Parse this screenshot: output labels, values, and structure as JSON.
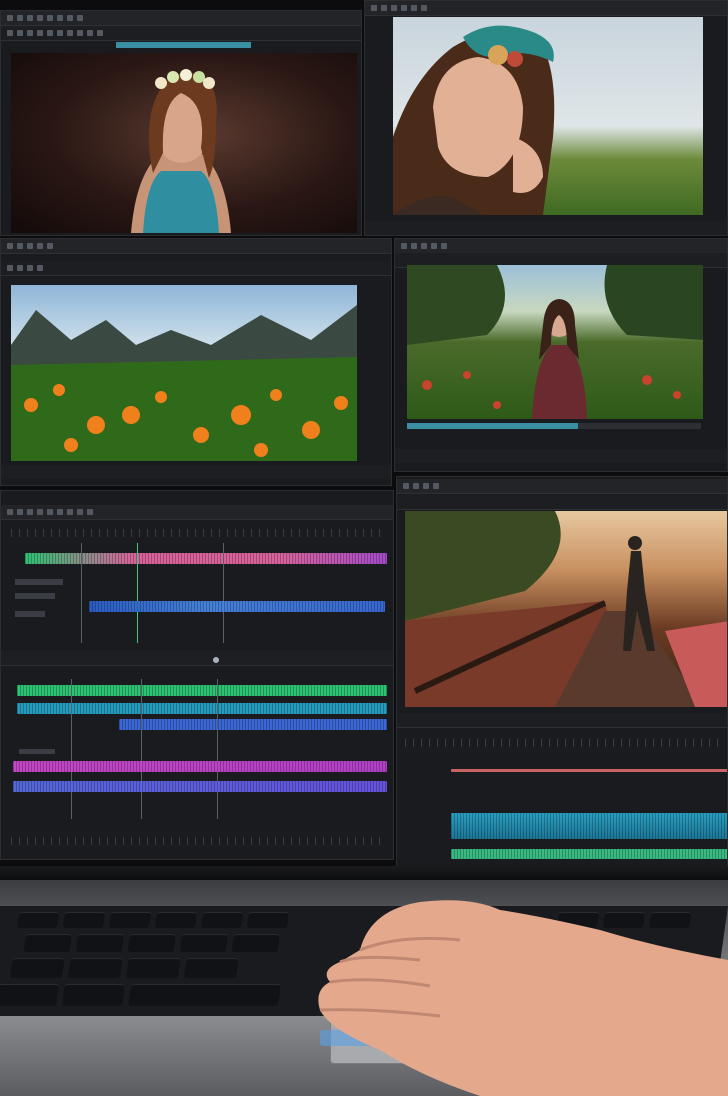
{
  "scene": {
    "description_tags": [
      "video-editing-workstation",
      "monitor-grid",
      "laptop",
      "hand-on-trackpad"
    ],
    "accent_colors": {
      "scrub": "#3a8fa3",
      "green_track": "#2fd07a",
      "teal_track": "#24a5c9",
      "blue_track": "#3d6fe0",
      "magenta_track": "#d645c8",
      "pink_track": "#e86aa4",
      "violet_track": "#6b62f0"
    }
  },
  "panels": {
    "top_left": {
      "header": "",
      "icon": "viewer-icon"
    },
    "top_right": {
      "header": "",
      "icon": "viewer-icon"
    },
    "mid_left": {
      "header": "",
      "icon": "viewer-icon"
    },
    "mid_right": {
      "header": "",
      "icon": "viewer-icon"
    },
    "timeline_left": {
      "track_labels": [],
      "tracks": [
        {
          "color": "#e96aa6",
          "icon": "audio-track"
        },
        {
          "color": "#3b74e0",
          "icon": "video-track"
        },
        {
          "color": "#2fd07a",
          "icon": "video-track"
        },
        {
          "color": "#26a6cc",
          "icon": "video-track"
        },
        {
          "color": "#3f6fe6",
          "icon": "video-track"
        },
        {
          "color": "#d24ad2",
          "icon": "audio-track"
        },
        {
          "color": "#6d58ee",
          "icon": "audio-track"
        }
      ]
    },
    "bottom_right": {
      "header": "",
      "tracks": [
        {
          "color": "#d86a6a"
        },
        {
          "color": "#2aa9cf"
        },
        {
          "color": "#3cc889"
        }
      ]
    }
  },
  "monitor_label": ""
}
